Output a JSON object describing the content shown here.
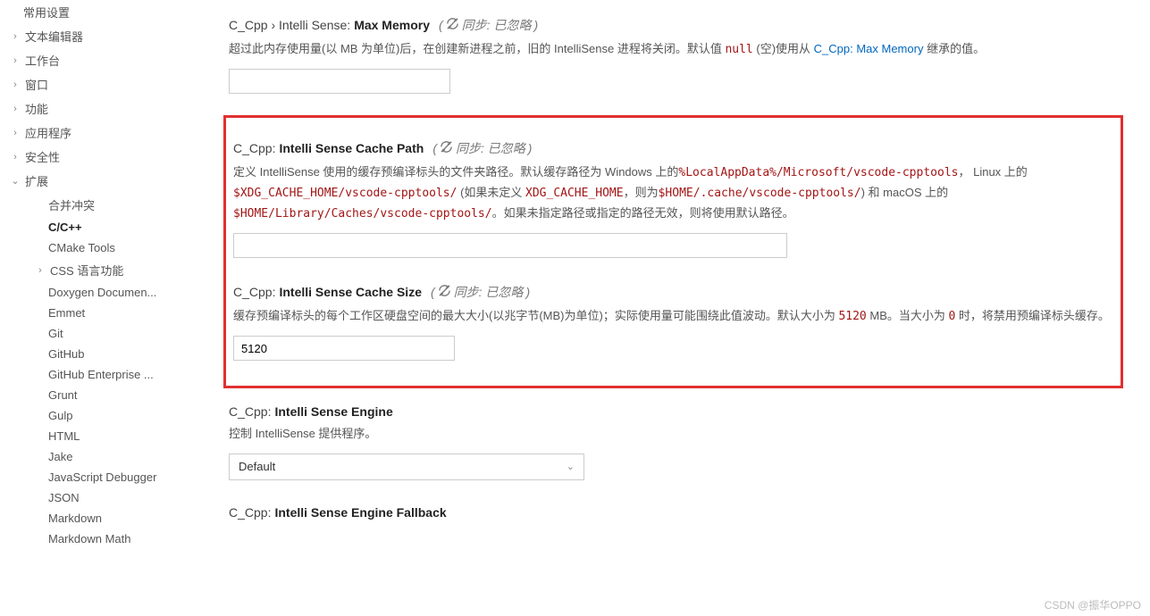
{
  "sidebar": {
    "items": [
      {
        "label": "常用设置",
        "expand": "",
        "level": 0,
        "selected": false,
        "hasChevron": false
      },
      {
        "label": "文本编辑器",
        "expand": "›",
        "level": 0,
        "selected": false,
        "hasChevron": true
      },
      {
        "label": "工作台",
        "expand": "›",
        "level": 0,
        "selected": false,
        "hasChevron": true
      },
      {
        "label": "窗口",
        "expand": "›",
        "level": 0,
        "selected": false,
        "hasChevron": true
      },
      {
        "label": "功能",
        "expand": "›",
        "level": 0,
        "selected": false,
        "hasChevron": true
      },
      {
        "label": "应用程序",
        "expand": "›",
        "level": 0,
        "selected": false,
        "hasChevron": true
      },
      {
        "label": "安全性",
        "expand": "›",
        "level": 0,
        "selected": false,
        "hasChevron": true
      },
      {
        "label": "扩展",
        "expand": "⌄",
        "level": 0,
        "selected": false,
        "hasChevron": true
      },
      {
        "label": "合并冲突",
        "expand": "",
        "level": 1,
        "selected": false,
        "hasChevron": false
      },
      {
        "label": "C/C++",
        "expand": "",
        "level": 1,
        "selected": true,
        "hasChevron": false
      },
      {
        "label": "CMake Tools",
        "expand": "",
        "level": 1,
        "selected": false,
        "hasChevron": false
      },
      {
        "label": "CSS 语言功能",
        "expand": "›",
        "level": 1,
        "selected": false,
        "hasChevron": true
      },
      {
        "label": "Doxygen Documen...",
        "expand": "",
        "level": 1,
        "selected": false,
        "hasChevron": false
      },
      {
        "label": "Emmet",
        "expand": "",
        "level": 1,
        "selected": false,
        "hasChevron": false
      },
      {
        "label": "Git",
        "expand": "",
        "level": 1,
        "selected": false,
        "hasChevron": false
      },
      {
        "label": "GitHub",
        "expand": "",
        "level": 1,
        "selected": false,
        "hasChevron": false
      },
      {
        "label": "GitHub Enterprise ...",
        "expand": "",
        "level": 1,
        "selected": false,
        "hasChevron": false
      },
      {
        "label": "Grunt",
        "expand": "",
        "level": 1,
        "selected": false,
        "hasChevron": false
      },
      {
        "label": "Gulp",
        "expand": "",
        "level": 1,
        "selected": false,
        "hasChevron": false
      },
      {
        "label": "HTML",
        "expand": "",
        "level": 1,
        "selected": false,
        "hasChevron": false
      },
      {
        "label": "Jake",
        "expand": "",
        "level": 1,
        "selected": false,
        "hasChevron": false
      },
      {
        "label": "JavaScript Debugger",
        "expand": "",
        "level": 1,
        "selected": false,
        "hasChevron": false
      },
      {
        "label": "JSON",
        "expand": "",
        "level": 1,
        "selected": false,
        "hasChevron": false
      },
      {
        "label": "Markdown",
        "expand": "",
        "level": 1,
        "selected": false,
        "hasChevron": false
      },
      {
        "label": "Markdown Math",
        "expand": "",
        "level": 1,
        "selected": false,
        "hasChevron": false
      }
    ]
  },
  "sync_label": "同步: 已忽略",
  "settings": {
    "maxMemory": {
      "prefix": "C_Cpp › Intelli Sense:",
      "name": "Max Memory",
      "desc_a": "超过此内存使用量(以 MB 为单位)后，在创建新进程之前，旧的 IntelliSense 进程将关闭。默认值 ",
      "desc_code": "null",
      "desc_b": " (空)使用从 ",
      "desc_link": "C_Cpp: Max Memory",
      "desc_c": " 继承的值。",
      "value": ""
    },
    "cachePath": {
      "prefix": "C_Cpp:",
      "name": "Intelli Sense Cache Path",
      "d1": "定义 IntelliSense 使用的缓存预编译标头的文件夹路径。默认缓存路径为 Windows 上的",
      "c1": "%LocalAppData%/Microsoft/vscode-cpptools",
      "d2": "， Linux 上的 ",
      "c2": "$XDG_CACHE_HOME/vscode-cpptools/",
      "d3": " (如果未定义 ",
      "c3": "XDG_CACHE_HOME",
      "d4": "，则为",
      "c4": "$HOME/.cache/vscode-cpptools/",
      "d5": ") 和 macOS 上的 ",
      "c5": "$HOME/Library/Caches/vscode-cpptools/",
      "d6": "。如果未指定路径或指定的路径无效，则将使用默认路径。",
      "value": ""
    },
    "cacheSize": {
      "prefix": "C_Cpp:",
      "name": "Intelli Sense Cache Size",
      "d1": "缓存预编译标头的每个工作区硬盘空间的最大大小(以兆字节(MB)为单位)；实际使用量可能围绕此值波动。默认大小为 ",
      "c1": "5120",
      "d2": " MB。当大小为 ",
      "c2": "0",
      "d3": " 时，将禁用预编译标头缓存。",
      "value": "5120"
    },
    "engine": {
      "prefix": "C_Cpp:",
      "name": "Intelli Sense Engine",
      "desc": "控制 IntelliSense 提供程序。",
      "value": "Default"
    },
    "engineFallback": {
      "prefix": "C_Cpp:",
      "name": "Intelli Sense Engine Fallback"
    }
  },
  "watermark": "CSDN @振华OPPO"
}
